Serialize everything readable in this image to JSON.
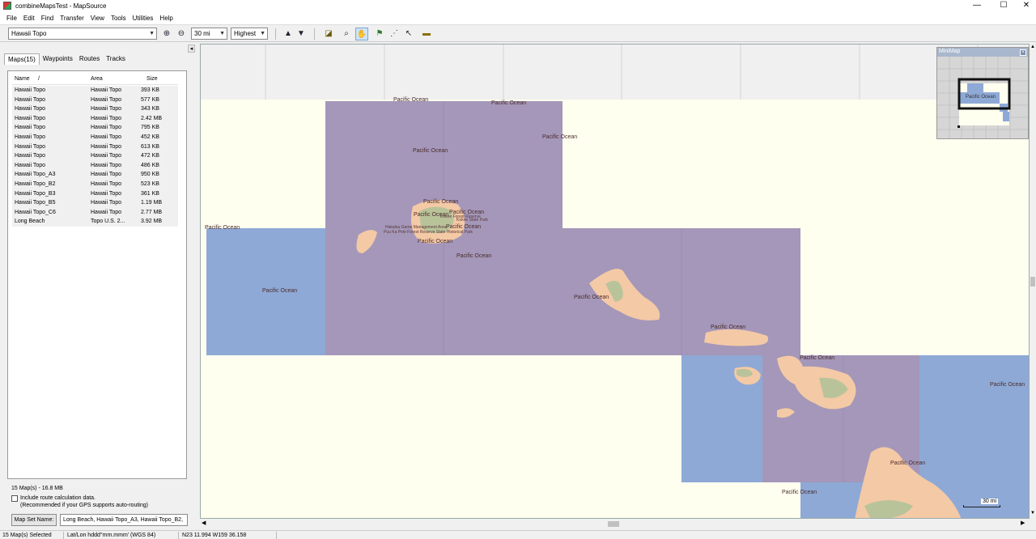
{
  "window": {
    "title": "combineMapsTest - MapSource",
    "controls": [
      "—",
      "☐",
      "✕"
    ]
  },
  "menu": [
    "File",
    "Edit",
    "Find",
    "Transfer",
    "View",
    "Tools",
    "Utilities",
    "Help"
  ],
  "toolbar": {
    "product_select": "Hawaii Topo",
    "zoom_select": "30 mi",
    "detail_select": "Highest",
    "tools": [
      "zoom-in-icon",
      "zoom-out-icon",
      "send-to-device-icon",
      "receive-from-device-icon",
      "map-tool-icon",
      "zoom-tool-icon",
      "hand-tool-icon",
      "waypoint-tool-icon",
      "route-tool-icon",
      "selection-tool-icon",
      "distance-tool-icon"
    ]
  },
  "left_panel": {
    "tabs": [
      "Maps(15)",
      "Waypoints",
      "Routes",
      "Tracks"
    ],
    "columns": [
      "Name",
      "/",
      "Area",
      "Size"
    ],
    "rows": [
      [
        "Hawaii Topo",
        "Hawaii Topo",
        "393 KB"
      ],
      [
        "Hawaii Topo",
        "Hawaii Topo",
        "577 KB"
      ],
      [
        "Hawaii Topo",
        "Hawaii Topo",
        "343 KB"
      ],
      [
        "Hawaii Topo",
        "Hawaii Topo",
        "2.42 MB"
      ],
      [
        "Hawaii Topo",
        "Hawaii Topo",
        "795 KB"
      ],
      [
        "Hawaii Topo",
        "Hawaii Topo",
        "452 KB"
      ],
      [
        "Hawaii Topo",
        "Hawaii Topo",
        "613 KB"
      ],
      [
        "Hawaii Topo",
        "Hawaii Topo",
        "472 KB"
      ],
      [
        "Hawaii Topo",
        "Hawaii Topo",
        "486 KB"
      ],
      [
        "Hawaii Topo_A3",
        "Hawaii Topo",
        "950 KB"
      ],
      [
        "Hawaii Topo_B2",
        "Hawaii Topo",
        "523 KB"
      ],
      [
        "Hawaii Topo_B3",
        "Hawaii Topo",
        "361 KB"
      ],
      [
        "Hawaii Topo_B5",
        "Hawaii Topo",
        "1.19 MB"
      ],
      [
        "Hawaii Topo_C6",
        "Hawaii Topo",
        "2.77 MB"
      ],
      [
        "Long Beach",
        "Topo U.S. 2...",
        "3.92 MB"
      ]
    ],
    "summary": "15 Map(s) - 16.8 MB",
    "route_calc_label": "Include route calculation data.",
    "route_calc_note": "(Recommended if your GPS supports auto-routing)",
    "route_calc_checked": false,
    "map_set_button": "Map Set Name:",
    "map_set_value": "Long Beach, Hawaii Topo_A3, Hawaii Topo_B2,"
  },
  "map": {
    "labels": [
      "Pacific Ocean",
      "Pacific Ocean",
      "Pacific Ocean",
      "Pacific Ocean",
      "Pacific Ocean",
      "Pacific Ocean",
      "Pacific Ocean",
      "Pacific Ocean",
      "Pacific Ocean",
      "Pacific Ocean",
      "Pacific Ocean",
      "Pacific Ocean",
      "Pacific Ocean",
      "Pacific Ocean",
      "Pacific Ocean",
      "Pacific Ocean",
      "Pacific Ocean",
      "Pacific Ocean"
    ],
    "small_labels": [
      "Kokee Forest Reserve",
      "Kokee State Park",
      "Hakalau Game Management Area",
      "Puu Ka Pele Forest Reserve State Historical Park"
    ],
    "minimap_title": "MiniMap",
    "minimap_label": "Pacific Ocean",
    "scale_label": "30 mi",
    "colors": {
      "ocean_unloaded": "#fffff0",
      "selected_tile": "#a497b9",
      "blue_tile": "#8ea9d6",
      "land": "#f4c9a5",
      "vegetation": "#b9c39a",
      "grid": "#e4e4e4"
    }
  },
  "status": {
    "selected": "15 Map(s) Selected",
    "format": "Lat/Lon hddd°mm.mmm' (WGS 84)",
    "position": "N23 11.994 W159 36.158"
  }
}
